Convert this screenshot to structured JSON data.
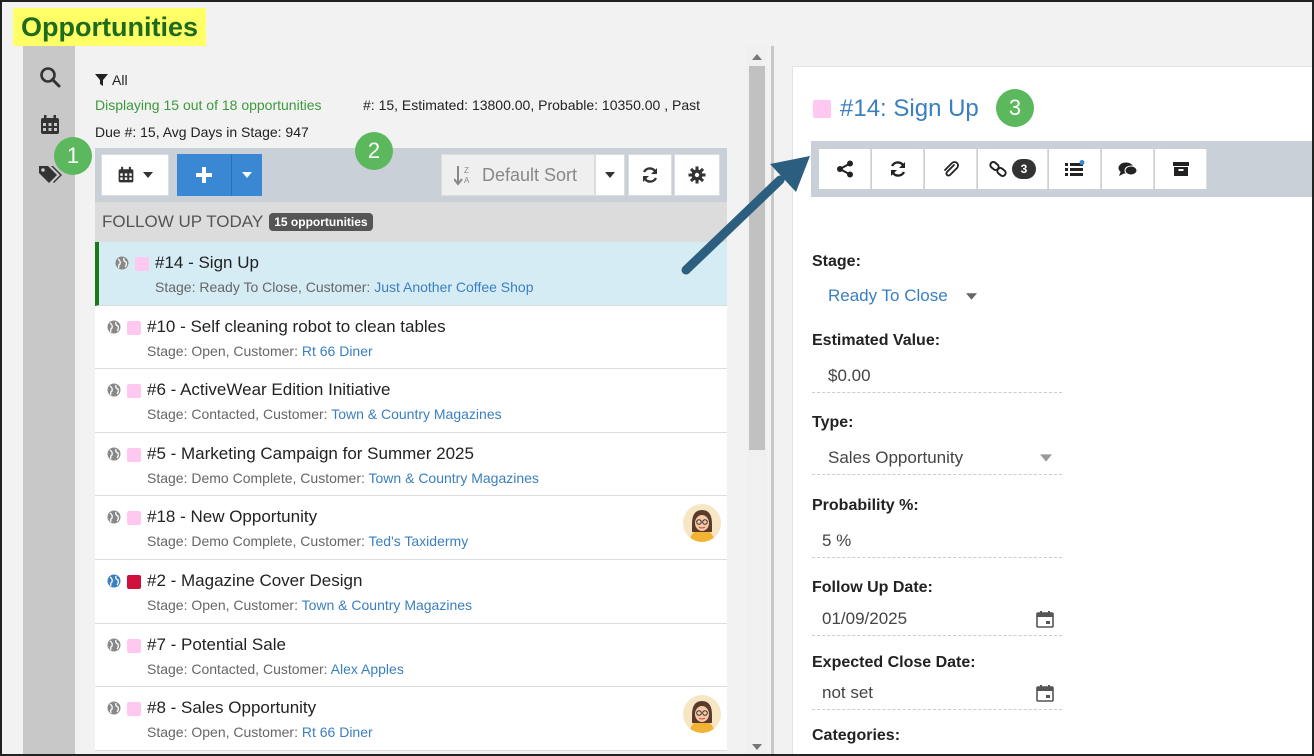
{
  "page": {
    "title": "Opportunities"
  },
  "rail": {
    "icons": [
      "search-icon",
      "calendar-icon",
      "tags-icon"
    ]
  },
  "list": {
    "filter_label": "All",
    "displaying": "Displaying 15 out of 18 opportunities",
    "stats": "#: 15, Estimated: 13800.00, Probable: 10350.00 , Past",
    "due": "Due #: 15, Avg Days in Stage: 947",
    "sort_label": "Default Sort",
    "group": {
      "title": "FOLLOW UP TODAY",
      "badge": "15 opportunities"
    },
    "items": [
      {
        "title": "#14 - Sign Up",
        "stage_prefix": "Stage: Ready To Close, Customer: ",
        "customer": "Just Another Coffee Shop",
        "color": "#ffc8f0",
        "globe": "#888888"
      },
      {
        "title": "#10 - Self cleaning robot to clean tables",
        "stage_prefix": "Stage: Open, Customer: ",
        "customer": "Rt 66 Diner",
        "color": "#ffc8f0",
        "globe": "#888888"
      },
      {
        "title": "#6 - ActiveWear Edition Initiative",
        "stage_prefix": "Stage: Contacted, Customer: ",
        "customer": "Town & Country Magazines",
        "color": "#ffc8f0",
        "globe": "#888888"
      },
      {
        "title": "#5 - Marketing Campaign for Summer 2025",
        "stage_prefix": "Stage: Demo Complete, Customer: ",
        "customer": "Town & Country Magazines",
        "color": "#ffc8f0",
        "globe": "#888888"
      },
      {
        "title": "#18 - New Opportunity",
        "stage_prefix": "Stage: Demo Complete, Customer: ",
        "customer": "Ted's Taxidermy",
        "color": "#ffc8f0",
        "globe": "#888888"
      },
      {
        "title": "#2 - Magazine Cover Design",
        "stage_prefix": "Stage: Open, Customer: ",
        "customer": "Town & Country Magazines",
        "color": "#d0103a",
        "globe": "#3a7fc0"
      },
      {
        "title": "#7 - Potential Sale",
        "stage_prefix": "Stage: Contacted, Customer: ",
        "customer": "Alex Apples",
        "color": "#ffc8f0",
        "globe": "#888888"
      },
      {
        "title": "#8 - Sales Opportunity",
        "stage_prefix": "Stage: Open, Customer: ",
        "customer": "Rt 66 Diner",
        "color": "#ffc8f0",
        "globe": "#888888"
      }
    ]
  },
  "detail": {
    "title": "#14: Sign Up",
    "link_count": "3",
    "fields": {
      "stage_label": "Stage:",
      "stage_value": "Ready To Close",
      "estimated_label": "Estimated Value:",
      "estimated_value": "$0.00",
      "type_label": "Type:",
      "type_value": "Sales Opportunity",
      "probability_label": "Probability %:",
      "probability_value": "5 %",
      "followup_label": "Follow Up Date:",
      "followup_value": "01/09/2025",
      "close_label": "Expected Close Date:",
      "close_value": "not set",
      "categories_label": "Categories:"
    }
  },
  "callouts": [
    "1",
    "2",
    "3"
  ],
  "colors": {
    "accent": "#3a87d4",
    "highlight": "#ffff66",
    "callout": "#5cb85c",
    "arrow": "#2c5f7f"
  }
}
